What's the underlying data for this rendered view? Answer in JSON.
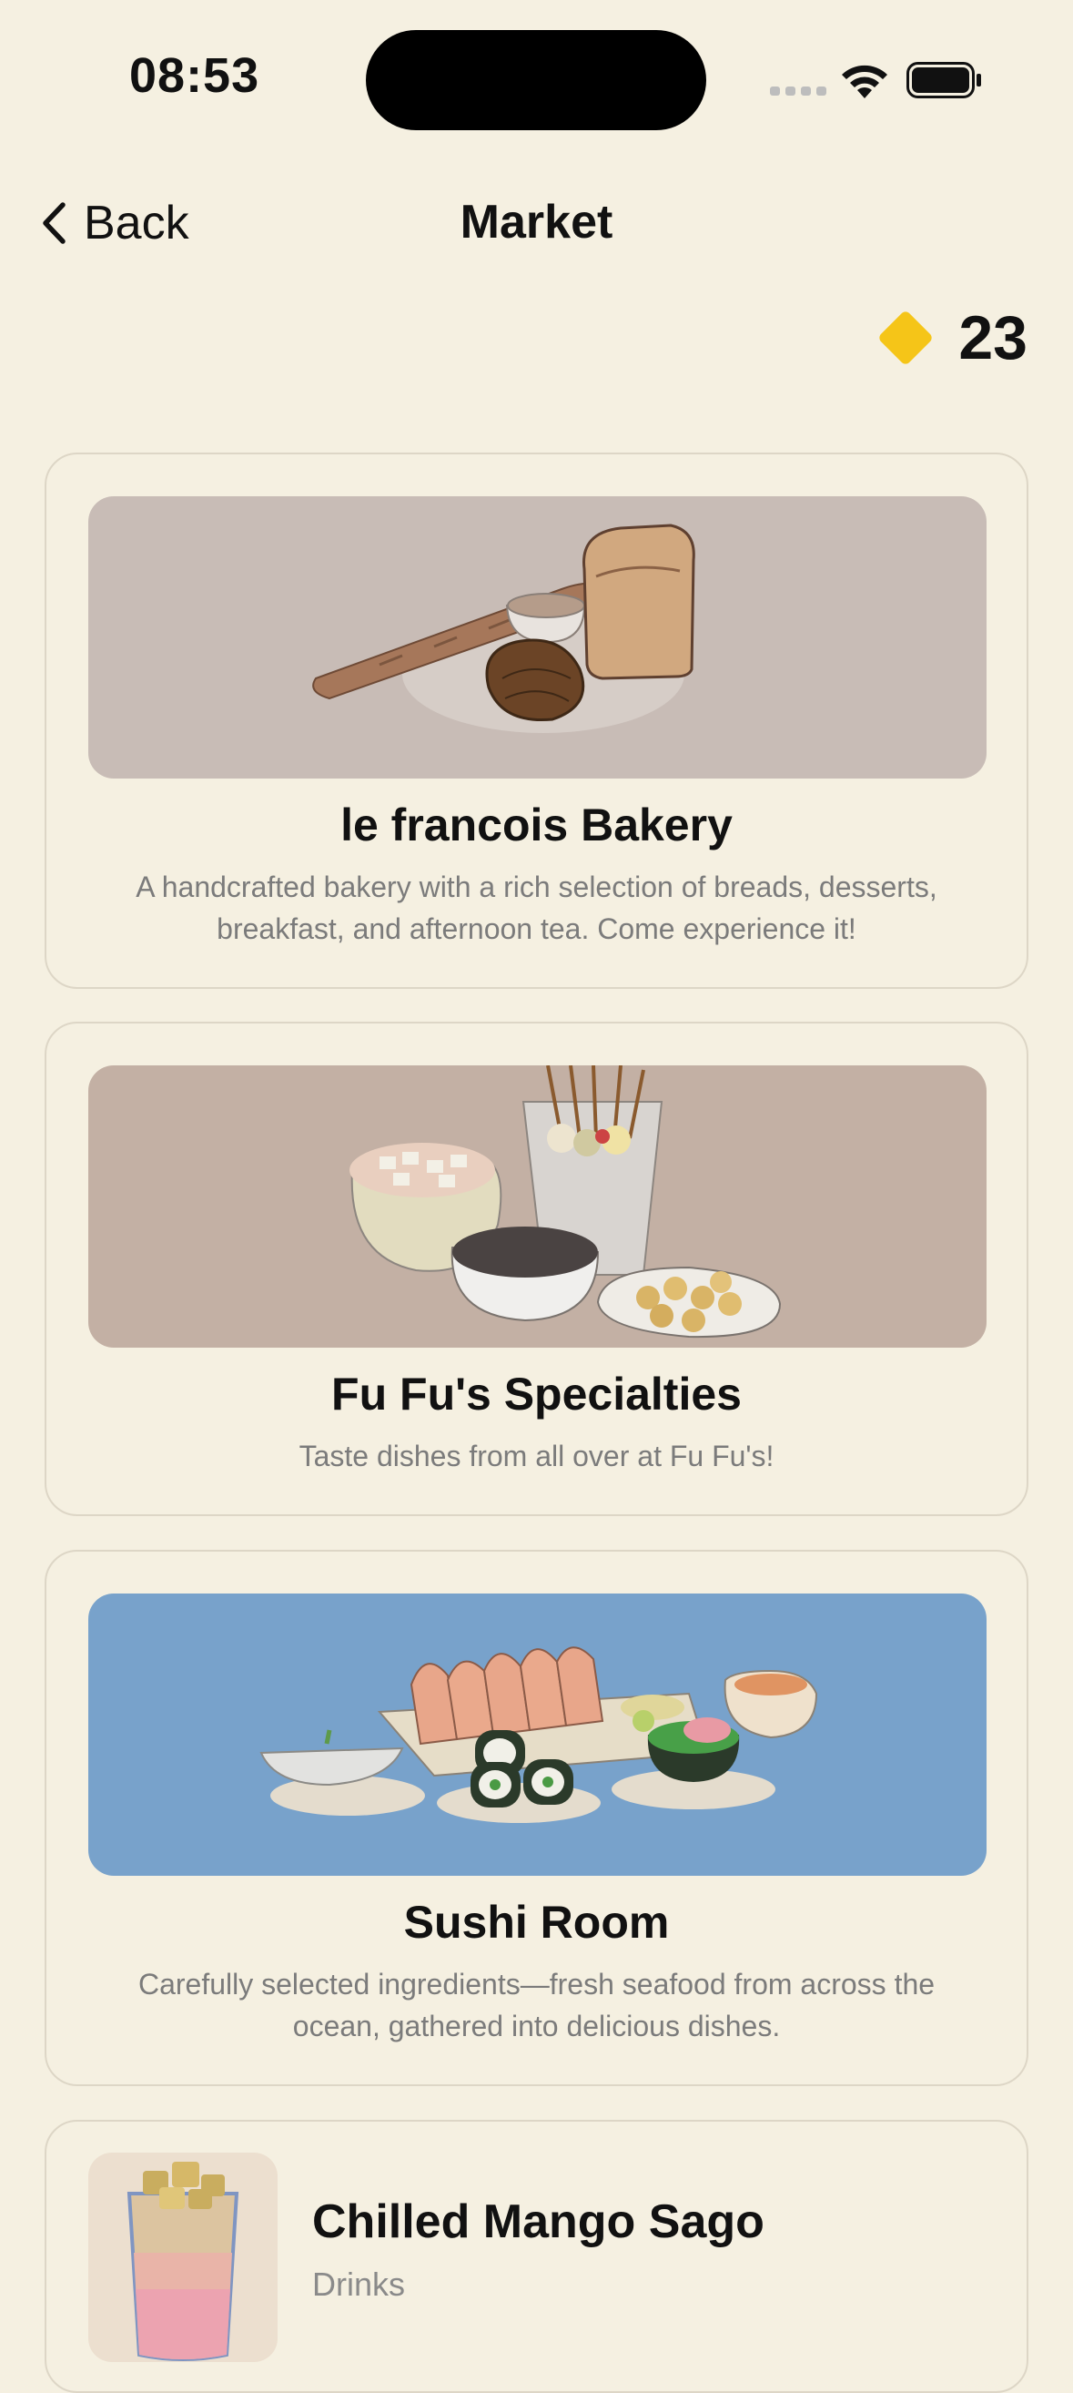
{
  "status": {
    "time": "08:53"
  },
  "nav": {
    "back_label": "Back",
    "title": "Market"
  },
  "currency": {
    "count": "23",
    "icon": "diamond-coin-icon",
    "color": "#f5c518"
  },
  "shops": [
    {
      "name": "le francois Bakery",
      "description": "A handcrafted bakery with a rich selection of breads, desserts, breakfast, and afternoon tea. Come experience it!",
      "image_bg": "#c8bcb6"
    },
    {
      "name": "Fu Fu's Specialties",
      "description": "Taste dishes from all over at Fu Fu's!",
      "image_bg": "#c3b0a4"
    },
    {
      "name": "Sushi Room",
      "description": "Carefully selected ingredients—fresh seafood from across the ocean, gathered into delicious dishes.",
      "image_bg": "#78a2cb"
    }
  ],
  "item": {
    "name": "Chilled Mango Sago",
    "category": "Drinks"
  }
}
